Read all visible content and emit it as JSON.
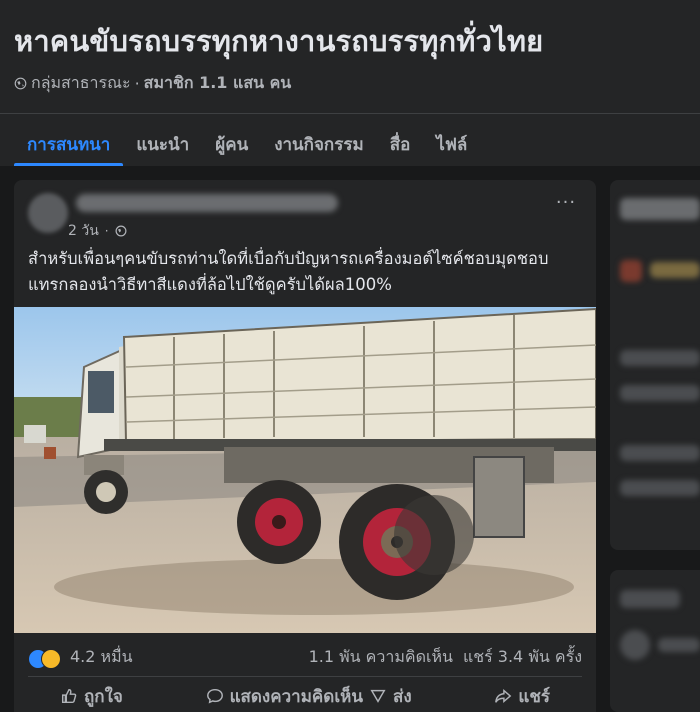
{
  "group": {
    "title": "หาคนขับรถบรรทุกหางานรถบรรทุกทั่วไทย",
    "privacy": "กลุ่มสาธารณะ",
    "separator": "·",
    "members": "สมาชิก 1.1 แสน คน"
  },
  "tabs": [
    {
      "label": "การสนทนา",
      "active": true
    },
    {
      "label": "แนะนำ"
    },
    {
      "label": "ผู้คน"
    },
    {
      "label": "งานกิจกรรม"
    },
    {
      "label": "สื่อ"
    },
    {
      "label": "ไฟล์"
    }
  ],
  "post": {
    "time": "2 วัน",
    "time_dot": "·",
    "more": "···",
    "text": "สำหรับเพื่อนๆคนขับรถท่านใดที่เบื่อกับปัญหารถเครื่องมอต์ไซค์ชอบมุดชอบแทรกลองนำวิธีทาสีแดงที่ล้อไปใช้ดูครับได้ผล100%",
    "reactions_count": "4.2 หมื่น",
    "comments": "1.1 พัน ความคิดเห็น",
    "shares": "แชร์ 3.4 พัน ครั้ง",
    "actions": {
      "like": "ถูกใจ",
      "comment": "แสดงความคิดเห็น",
      "send": "ส่ง",
      "share": "แชร์"
    }
  },
  "colors": {
    "accent": "#2d88ff",
    "background": "#18191a",
    "card": "#242526",
    "wheel_red": "#b3243a"
  },
  "icons": [
    "globe-icon",
    "more-icon",
    "like-reaction-icon",
    "haha-reaction-icon",
    "thumbs-up-icon",
    "comment-icon",
    "send-icon",
    "share-icon"
  ]
}
